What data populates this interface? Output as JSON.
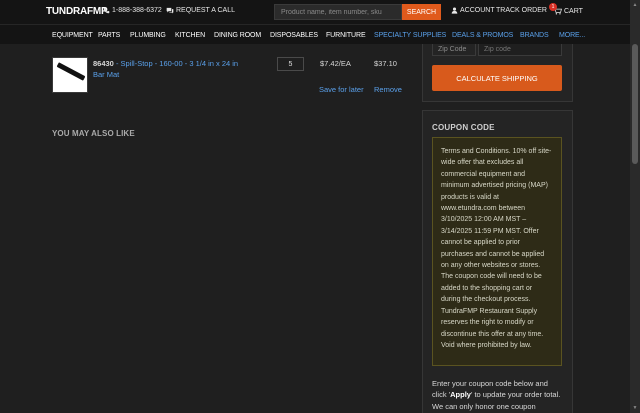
{
  "header": {
    "logo": "TUNDRAFMP",
    "phone": "1-888-388-6372",
    "request_call": "REQUEST A CALL",
    "search_placeholder": "Product name, item number, sku",
    "search_button": "SEARCH",
    "account": "ACCOUNT",
    "track_order": "TRACK ORDER",
    "cart": "CART",
    "cart_count": "1",
    "icons": [
      "phone-icon",
      "chat-icon",
      "user-icon",
      "cart-icon"
    ]
  },
  "nav": {
    "items": [
      {
        "label": "EQUIPMENT"
      },
      {
        "label": "PARTS"
      },
      {
        "label": "PLUMBING"
      },
      {
        "label": "KITCHEN"
      },
      {
        "label": "DINING ROOM"
      },
      {
        "label": "DISPOSABLES"
      },
      {
        "label": "FURNITURE"
      },
      {
        "label": "SPECIALTY SUPPLIES"
      },
      {
        "label": "DEALS & PROMOS"
      },
      {
        "label": "BRANDS"
      },
      {
        "label": "MORE..."
      }
    ],
    "highlight_color": "#5aa0ea"
  },
  "cart_item": {
    "sku": "86430",
    "separator": " - ",
    "name": "Spill-Stop - 160-00 - 3 1/4 in x 24 in Bar Mat",
    "quantity": "5",
    "unit_price": "$7.42/EA",
    "total": "$37.10",
    "save_for_later": "Save for later",
    "remove": "Remove"
  },
  "recommendations": {
    "heading": "YOU MAY ALSO LIKE"
  },
  "shipping": {
    "zip_label": "Zip Code",
    "zip_placeholder": "Zip code",
    "calculate_button": "CALCULATE SHIPPING"
  },
  "coupon": {
    "title": "COUPON CODE",
    "terms": "Terms and Conditions. 10% off site-wide offer that excludes all commercial equipment and minimum advertised pricing (MAP) products is valid at www.etundra.com between 3/10/2025 12:00 AM MST – 3/14/2025 11:59 PM MST. Offer cannot be applied to prior purchases and cannot be applied on any other websites or stores. The coupon code will need to be added to the shopping cart or during the checkout process. TundraFMP Restaurant Supply reserves the right to modify or discontinue this offer at any time. Void where prohibited by law.",
    "help_prefix": "Enter your coupon code below and click '",
    "help_apply": "Apply",
    "help_suffix": "' to update your order total. We can only honor one coupon"
  },
  "colors": {
    "accent_orange": "#e05a1c",
    "link_blue": "#5aa0ea",
    "terms_bg": "#2e2b17",
    "page_bg": "#1f1f1f"
  }
}
